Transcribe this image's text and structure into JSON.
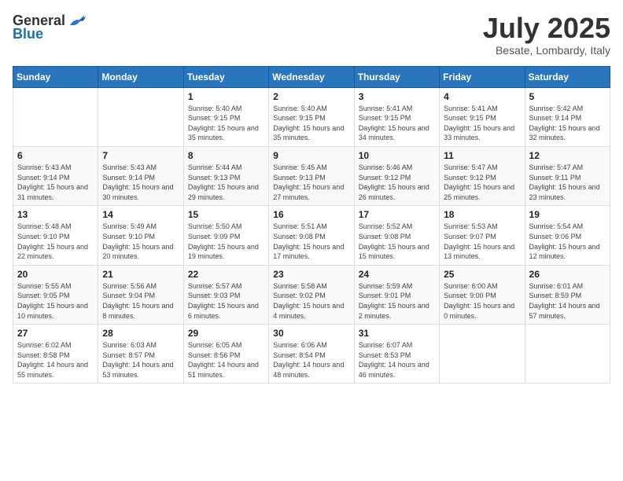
{
  "header": {
    "logo_general": "General",
    "logo_blue": "Blue",
    "month_title": "July 2025",
    "location": "Besate, Lombardy, Italy"
  },
  "weekdays": [
    "Sunday",
    "Monday",
    "Tuesday",
    "Wednesday",
    "Thursday",
    "Friday",
    "Saturday"
  ],
  "weeks": [
    [
      {
        "day": "",
        "info": ""
      },
      {
        "day": "",
        "info": ""
      },
      {
        "day": "1",
        "info": "Sunrise: 5:40 AM\nSunset: 9:15 PM\nDaylight: 15 hours and 35 minutes."
      },
      {
        "day": "2",
        "info": "Sunrise: 5:40 AM\nSunset: 9:15 PM\nDaylight: 15 hours and 35 minutes."
      },
      {
        "day": "3",
        "info": "Sunrise: 5:41 AM\nSunset: 9:15 PM\nDaylight: 15 hours and 34 minutes."
      },
      {
        "day": "4",
        "info": "Sunrise: 5:41 AM\nSunset: 9:15 PM\nDaylight: 15 hours and 33 minutes."
      },
      {
        "day": "5",
        "info": "Sunrise: 5:42 AM\nSunset: 9:14 PM\nDaylight: 15 hours and 32 minutes."
      }
    ],
    [
      {
        "day": "6",
        "info": "Sunrise: 5:43 AM\nSunset: 9:14 PM\nDaylight: 15 hours and 31 minutes."
      },
      {
        "day": "7",
        "info": "Sunrise: 5:43 AM\nSunset: 9:14 PM\nDaylight: 15 hours and 30 minutes."
      },
      {
        "day": "8",
        "info": "Sunrise: 5:44 AM\nSunset: 9:13 PM\nDaylight: 15 hours and 29 minutes."
      },
      {
        "day": "9",
        "info": "Sunrise: 5:45 AM\nSunset: 9:13 PM\nDaylight: 15 hours and 27 minutes."
      },
      {
        "day": "10",
        "info": "Sunrise: 5:46 AM\nSunset: 9:12 PM\nDaylight: 15 hours and 26 minutes."
      },
      {
        "day": "11",
        "info": "Sunrise: 5:47 AM\nSunset: 9:12 PM\nDaylight: 15 hours and 25 minutes."
      },
      {
        "day": "12",
        "info": "Sunrise: 5:47 AM\nSunset: 9:11 PM\nDaylight: 15 hours and 23 minutes."
      }
    ],
    [
      {
        "day": "13",
        "info": "Sunrise: 5:48 AM\nSunset: 9:10 PM\nDaylight: 15 hours and 22 minutes."
      },
      {
        "day": "14",
        "info": "Sunrise: 5:49 AM\nSunset: 9:10 PM\nDaylight: 15 hours and 20 minutes."
      },
      {
        "day": "15",
        "info": "Sunrise: 5:50 AM\nSunset: 9:09 PM\nDaylight: 15 hours and 19 minutes."
      },
      {
        "day": "16",
        "info": "Sunrise: 5:51 AM\nSunset: 9:08 PM\nDaylight: 15 hours and 17 minutes."
      },
      {
        "day": "17",
        "info": "Sunrise: 5:52 AM\nSunset: 9:08 PM\nDaylight: 15 hours and 15 minutes."
      },
      {
        "day": "18",
        "info": "Sunrise: 5:53 AM\nSunset: 9:07 PM\nDaylight: 15 hours and 13 minutes."
      },
      {
        "day": "19",
        "info": "Sunrise: 5:54 AM\nSunset: 9:06 PM\nDaylight: 15 hours and 12 minutes."
      }
    ],
    [
      {
        "day": "20",
        "info": "Sunrise: 5:55 AM\nSunset: 9:05 PM\nDaylight: 15 hours and 10 minutes."
      },
      {
        "day": "21",
        "info": "Sunrise: 5:56 AM\nSunset: 9:04 PM\nDaylight: 15 hours and 8 minutes."
      },
      {
        "day": "22",
        "info": "Sunrise: 5:57 AM\nSunset: 9:03 PM\nDaylight: 15 hours and 6 minutes."
      },
      {
        "day": "23",
        "info": "Sunrise: 5:58 AM\nSunset: 9:02 PM\nDaylight: 15 hours and 4 minutes."
      },
      {
        "day": "24",
        "info": "Sunrise: 5:59 AM\nSunset: 9:01 PM\nDaylight: 15 hours and 2 minutes."
      },
      {
        "day": "25",
        "info": "Sunrise: 6:00 AM\nSunset: 9:00 PM\nDaylight: 15 hours and 0 minutes."
      },
      {
        "day": "26",
        "info": "Sunrise: 6:01 AM\nSunset: 8:59 PM\nDaylight: 14 hours and 57 minutes."
      }
    ],
    [
      {
        "day": "27",
        "info": "Sunrise: 6:02 AM\nSunset: 8:58 PM\nDaylight: 14 hours and 55 minutes."
      },
      {
        "day": "28",
        "info": "Sunrise: 6:03 AM\nSunset: 8:57 PM\nDaylight: 14 hours and 53 minutes."
      },
      {
        "day": "29",
        "info": "Sunrise: 6:05 AM\nSunset: 8:56 PM\nDaylight: 14 hours and 51 minutes."
      },
      {
        "day": "30",
        "info": "Sunrise: 6:06 AM\nSunset: 8:54 PM\nDaylight: 14 hours and 48 minutes."
      },
      {
        "day": "31",
        "info": "Sunrise: 6:07 AM\nSunset: 8:53 PM\nDaylight: 14 hours and 46 minutes."
      },
      {
        "day": "",
        "info": ""
      },
      {
        "day": "",
        "info": ""
      }
    ]
  ]
}
